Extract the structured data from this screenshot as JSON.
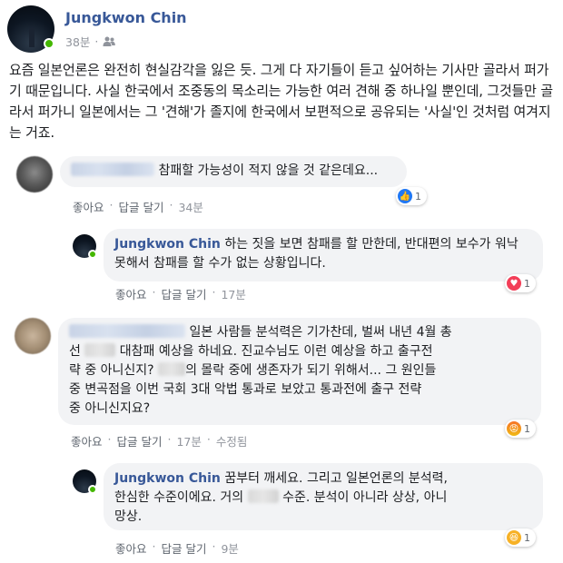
{
  "post": {
    "author": "Jungkwon Chin",
    "time": "38분",
    "privacy_icon": "friends-icon",
    "text": "요즘 일본언론은 완전히 현실감각을 잃은 듯. 그게 다 자기들이 듣고 싶어하는 기사만 골라서 퍼가기 때문입니다. 사실 한국에서 조중동의 목소리는 가능한 여러 견해 중 하나일 뿐인데, 그것들만 골라서 퍼가니 일본에서는 그 '견해'가 졸지에 한국에서 보편적으로 공유되는 '사실'인 것처럼 여겨지는 거죠."
  },
  "actions": {
    "like": "좋아요",
    "reply": "답글 달기",
    "edited": "수정됨"
  },
  "comments": [
    {
      "text": "참패할 가능성이 적지 않을 것 같은데요...",
      "time": "34분",
      "reaction_icon": "like-icon",
      "reaction_count": "1",
      "reply": {
        "author": "Jungkwon Chin",
        "text": "하는 짓을 보면 참패를 할 만한데, 반대편의 보수가 워낙 못해서 참패를 할 수가 없는 상황입니다.",
        "time": "17분",
        "reaction_icon": "love-icon",
        "reaction_count": "1"
      }
    },
    {
      "text_1": "일본 사람들 분석력은 기가찬데, 벌써 내년 4월 총",
      "text_2a": "선",
      "text_2b": "대참패 예상을 하네요. 진교수님도 이런 예상을 하고 출구전",
      "text_3a": "략 중 아니신지?",
      "text_3b": "의 몰락 중에 생존자가 되기 위해서... 그 원인들",
      "text_4": "중 변곡점을 이번 국회 3대 악법 통과로 보았고 통과전에 출구 전략",
      "text_5": "중 아니신지요?",
      "time": "17분",
      "reaction_icon": "angry-icon",
      "reaction_count": "1",
      "reply": {
        "author": "Jungkwon Chin",
        "text_1": "꿈부터 깨세요. 그리고 일본언론의 분석력,",
        "text_2a": "한심한 수준이에요. 거의",
        "text_2b": "수준. 분석이 아니라 상상, 아니",
        "text_3": "망상.",
        "time": "9분",
        "reaction_icon": "haha-icon",
        "reaction_count": "1"
      }
    }
  ],
  "colors": {
    "name_blue": "#385898",
    "bubble_bg": "#f2f3f5",
    "meta_gray": "#90949c",
    "online_green": "#44b700"
  }
}
